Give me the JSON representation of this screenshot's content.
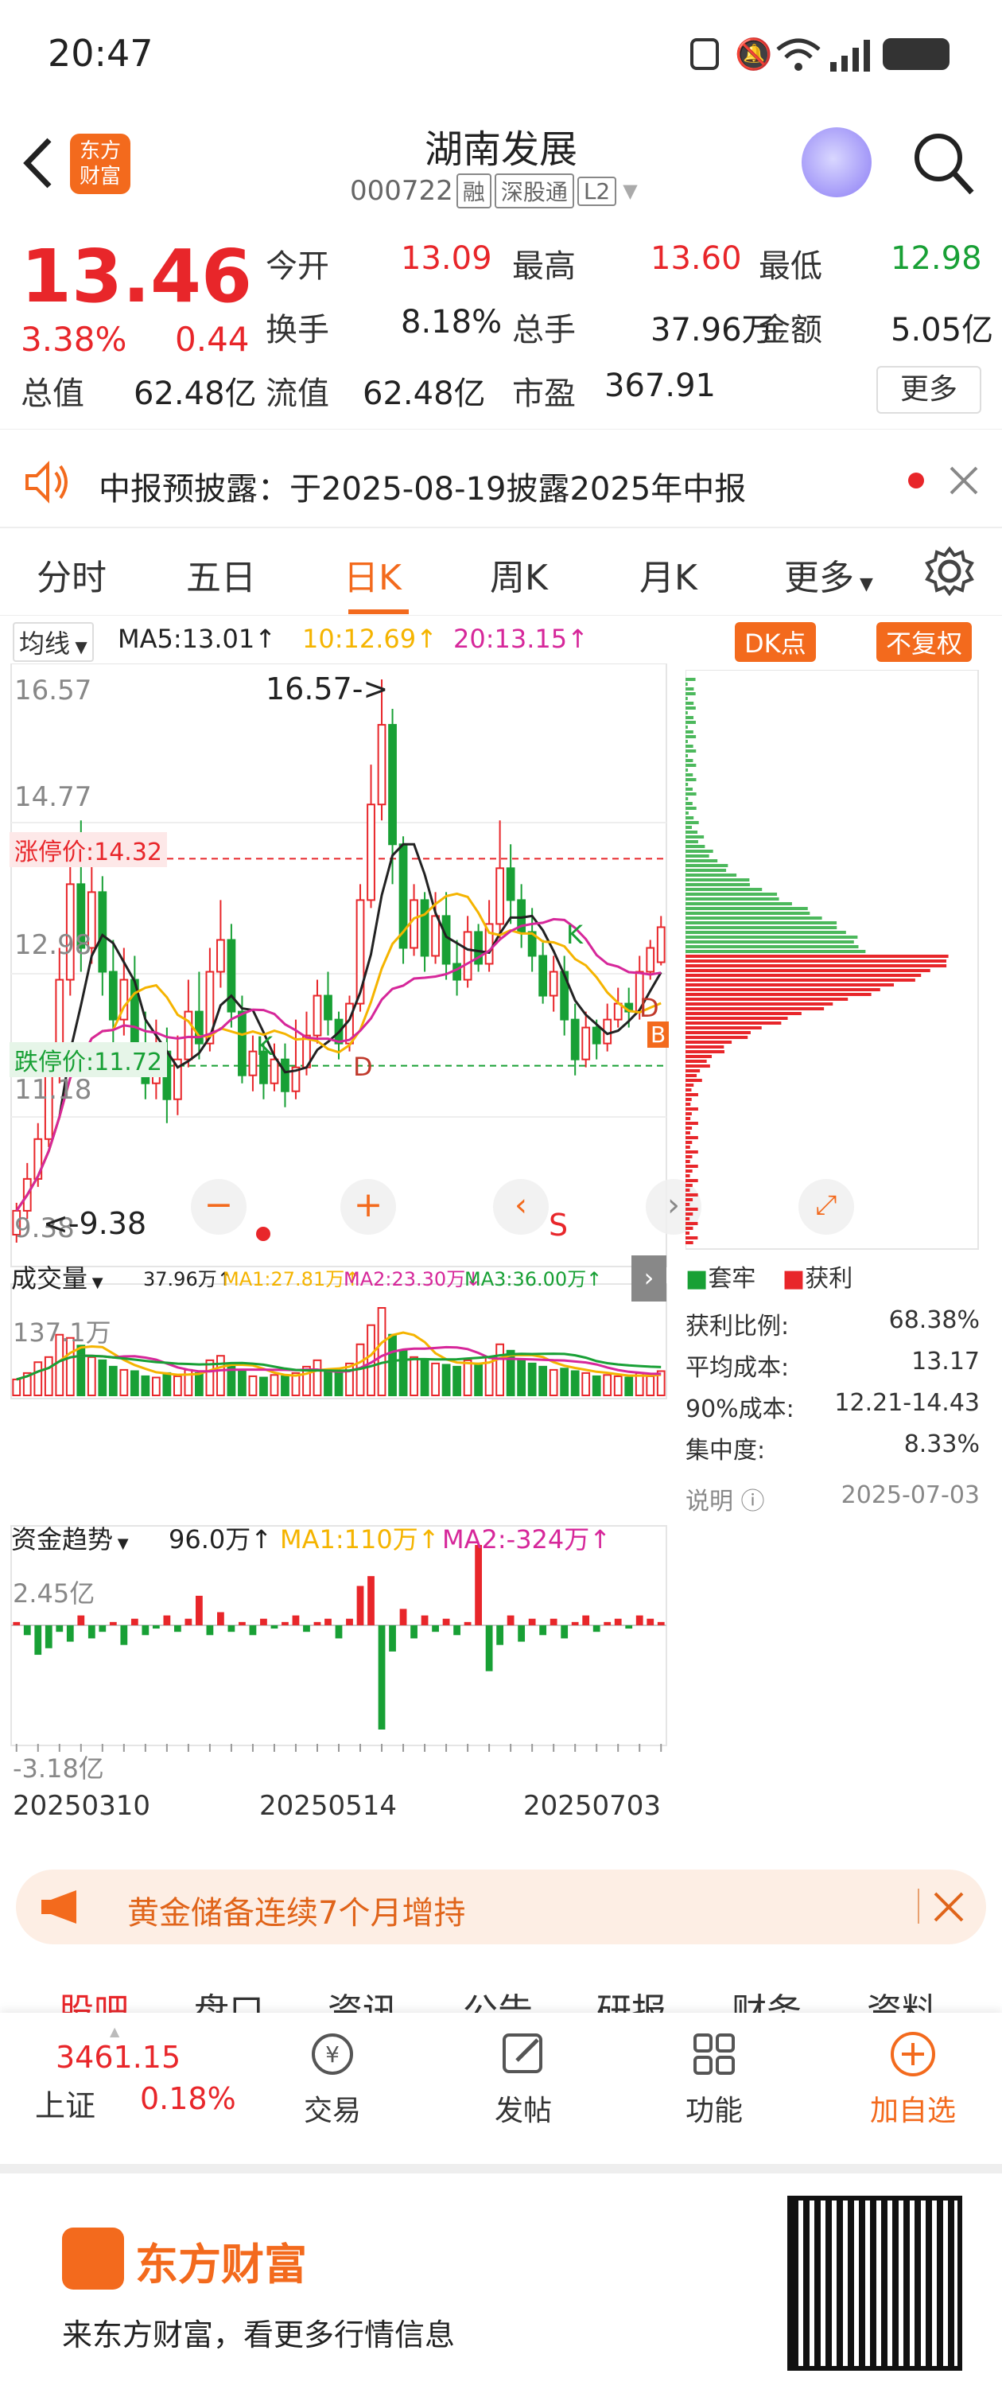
{
  "status": {
    "time": "20:47",
    "icons": [
      "nfc-icon",
      "mute-icon",
      "wifi-icon",
      "signal-icon",
      "battery-icon"
    ]
  },
  "header": {
    "title": "湖南发展",
    "code": "000722",
    "tags": [
      "融",
      "深股通",
      "L2"
    ],
    "logo_text": "东方\n财富"
  },
  "quote": {
    "price": "13.46",
    "change_pct": "3.38%",
    "change": "0.44",
    "stats": [
      {
        "label": "今开",
        "value": "13.09",
        "color": "red"
      },
      {
        "label": "最高",
        "value": "13.60",
        "color": "red"
      },
      {
        "label": "最低",
        "value": "12.98",
        "color": "green"
      },
      {
        "label": "换手",
        "value": "8.18%",
        "color": "dark"
      },
      {
        "label": "总手",
        "value": "37.96万",
        "color": "dark"
      },
      {
        "label": "金额",
        "value": "5.05亿",
        "color": "dark"
      },
      {
        "label": "总值",
        "value": "62.48亿",
        "color": "dark"
      },
      {
        "label": "流值",
        "value": "62.48亿",
        "color": "dark"
      },
      {
        "label": "市盈",
        "value": "367.91",
        "color": "dark"
      }
    ],
    "more_label": "更多"
  },
  "notice": {
    "text": "中报预披露：于2025-08-19披露2025年中报"
  },
  "tabs": [
    "分时",
    "五日",
    "日K",
    "周K",
    "月K",
    "更多"
  ],
  "active_tab": "日K",
  "kline": {
    "indicator": "均线",
    "ma5": "MA5:13.01↑",
    "ma10": "10:12.69↑",
    "ma20": "20:13.15↑",
    "dk_label": "DK点",
    "adjust_label": "不复权",
    "y_labels": [
      "16.57",
      "14.77",
      "12.98",
      "11.18"
    ],
    "high_mark": "16.57->",
    "low_mark": "<-9.38",
    "low_label": "9.38",
    "limit_up": "涨停价:14.32",
    "limit_down": "跌停价:11.72",
    "signal_labels": [
      "K",
      "D",
      "K",
      "D",
      "B",
      "S"
    ]
  },
  "chip": {
    "legend_hold": "套牢",
    "legend_profit": "获利",
    "rows": [
      {
        "label": "获利比例:",
        "value": "68.38%"
      },
      {
        "label": "平均成本:",
        "value": "13.17"
      },
      {
        "label": "90%成本:",
        "value": "12.21-14.43"
      },
      {
        "label": "集中度:",
        "value": "8.33%"
      }
    ],
    "note": "说明",
    "date": "2025-07-03"
  },
  "volume": {
    "label": "成交量",
    "v": "37.96万↑",
    "ma1": "MA1:27.81万↑",
    "ma2": "MA2:23.30万↓",
    "ma3": "MA3:36.00万↑",
    "max": "137.1万"
  },
  "fund": {
    "label": "资金趋势",
    "v": "96.0万↑",
    "ma1": "MA1:110万↑",
    "ma2": "MA2:-324万↑",
    "max": "2.45亿",
    "min": "-3.18亿"
  },
  "dates": [
    "20250310",
    "20250514",
    "20250703"
  ],
  "banner": {
    "text": "黄金储备连续7个月增持"
  },
  "bottom_tabs": [
    "股吧",
    "盘口",
    "资讯",
    "公告",
    "研报",
    "财务",
    "资料"
  ],
  "nav": {
    "index_value": "3461.15",
    "index_name": "上证",
    "index_pct": "0.18%",
    "items": [
      "交易",
      "发帖",
      "功能",
      "加自选"
    ]
  },
  "footer": {
    "brand": "东方财富",
    "slogan": "来东方财富，看更多行情信息"
  },
  "colors": {
    "up": "#e8262a",
    "down": "#18a035",
    "accent": "#f36a1d",
    "ma5": "#222222",
    "ma10": "#f5b400",
    "ma20": "#d6279a"
  },
  "chart_data": {
    "type": "candlestick",
    "y_range": [
      9.38,
      16.57
    ],
    "high": 16.57,
    "low": 9.38,
    "limit_up": 14.32,
    "limit_down": 11.72,
    "candles": [
      [
        9.6,
        9.9,
        9.5,
        10.0
      ],
      [
        9.9,
        10.3,
        9.8,
        10.5
      ],
      [
        10.3,
        10.8,
        10.2,
        11.0
      ],
      [
        10.8,
        11.6,
        10.7,
        11.8
      ],
      [
        11.6,
        12.8,
        11.5,
        13.2
      ],
      [
        12.8,
        14.0,
        12.6,
        14.5
      ],
      [
        14.0,
        13.2,
        12.9,
        14.8
      ],
      [
        13.2,
        13.9,
        13.0,
        14.3
      ],
      [
        13.9,
        12.9,
        12.6,
        14.1
      ],
      [
        12.9,
        12.3,
        12.0,
        13.3
      ],
      [
        12.3,
        12.8,
        12.1,
        13.2
      ],
      [
        12.8,
        12.0,
        11.8,
        13.1
      ],
      [
        12.0,
        11.5,
        11.3,
        12.4
      ],
      [
        11.5,
        11.9,
        11.3,
        12.3
      ],
      [
        11.9,
        11.3,
        11.0,
        12.2
      ],
      [
        11.3,
        11.8,
        11.1,
        12.1
      ],
      [
        11.8,
        12.4,
        11.7,
        12.8
      ],
      [
        12.4,
        12.0,
        11.8,
        12.9
      ],
      [
        12.0,
        12.9,
        11.9,
        13.2
      ],
      [
        12.9,
        13.3,
        12.7,
        13.8
      ],
      [
        13.3,
        12.4,
        12.2,
        13.5
      ],
      [
        12.4,
        11.6,
        11.5,
        12.6
      ],
      [
        11.6,
        11.9,
        11.4,
        12.1
      ],
      [
        11.9,
        11.5,
        11.3,
        12.0
      ],
      [
        11.5,
        11.8,
        11.4,
        12.0
      ],
      [
        11.8,
        11.4,
        11.2,
        12.0
      ],
      [
        11.4,
        11.7,
        11.3,
        12.3
      ],
      [
        11.7,
        12.1,
        11.6,
        12.4
      ],
      [
        12.1,
        12.6,
        12.0,
        12.8
      ],
      [
        12.6,
        12.3,
        12.1,
        12.9
      ],
      [
        12.3,
        12.0,
        11.8,
        12.4
      ],
      [
        12.0,
        12.5,
        11.9,
        12.6
      ],
      [
        12.5,
        13.8,
        12.4,
        14.0
      ],
      [
        13.8,
        15.0,
        13.7,
        15.5
      ],
      [
        15.0,
        16.0,
        14.8,
        16.57
      ],
      [
        16.0,
        14.5,
        14.0,
        16.2
      ],
      [
        14.5,
        13.2,
        13.0,
        14.6
      ],
      [
        13.2,
        13.8,
        13.1,
        14.0
      ],
      [
        13.8,
        13.1,
        12.9,
        13.9
      ],
      [
        13.1,
        13.6,
        13.0,
        13.9
      ],
      [
        13.6,
        13.0,
        12.8,
        13.9
      ],
      [
        13.0,
        12.8,
        12.6,
        13.3
      ],
      [
        12.8,
        13.4,
        12.7,
        13.6
      ],
      [
        13.4,
        13.0,
        12.9,
        13.5
      ],
      [
        13.0,
        13.5,
        12.9,
        13.8
      ],
      [
        13.5,
        14.2,
        13.3,
        14.8
      ],
      [
        14.2,
        13.8,
        13.5,
        14.5
      ],
      [
        13.8,
        13.4,
        13.2,
        14.0
      ],
      [
        13.4,
        13.1,
        12.9,
        13.7
      ],
      [
        13.1,
        12.6,
        12.5,
        13.3
      ],
      [
        12.6,
        12.9,
        12.4,
        13.1
      ],
      [
        12.9,
        12.3,
        12.1,
        13.1
      ],
      [
        12.3,
        11.8,
        11.6,
        12.5
      ],
      [
        11.8,
        12.2,
        11.7,
        12.4
      ],
      [
        12.2,
        12.0,
        11.8,
        12.3
      ],
      [
        12.0,
        12.3,
        11.9,
        12.5
      ],
      [
        12.3,
        12.5,
        12.2,
        12.7
      ],
      [
        12.5,
        12.4,
        12.2,
        12.7
      ],
      [
        12.4,
        12.9,
        12.3,
        13.1
      ],
      [
        12.9,
        13.2,
        12.8,
        13.3
      ],
      [
        13.02,
        13.46,
        12.98,
        13.6
      ]
    ],
    "volumes": [
      25,
      35,
      52,
      60,
      95,
      90,
      78,
      60,
      55,
      45,
      40,
      38,
      30,
      28,
      35,
      30,
      40,
      35,
      55,
      62,
      48,
      40,
      30,
      28,
      32,
      30,
      35,
      45,
      55,
      40,
      35,
      50,
      80,
      110,
      137,
      95,
      70,
      60,
      55,
      50,
      48,
      45,
      55,
      50,
      60,
      80,
      70,
      55,
      50,
      45,
      40,
      42,
      38,
      35,
      30,
      32,
      30,
      28,
      35,
      30,
      38
    ],
    "fund_flow": [
      0.1,
      -0.3,
      -0.9,
      -0.7,
      -0.2,
      -0.5,
      0.3,
      -0.4,
      -0.2,
      0.1,
      -0.6,
      0.2,
      -0.3,
      -0.1,
      0.3,
      -0.2,
      0.2,
      0.9,
      -0.3,
      0.4,
      -0.2,
      0.1,
      -0.3,
      0.2,
      -0.1,
      0.1,
      0.3,
      -0.2,
      0.1,
      0.2,
      -0.4,
      0.2,
      1.2,
      1.5,
      -3.18,
      -0.8,
      0.5,
      -0.4,
      0.3,
      -0.2,
      0.2,
      -0.3,
      0.1,
      2.45,
      -1.4,
      -0.6,
      0.3,
      -0.5,
      0.2,
      -0.3,
      0.2,
      -0.4,
      0.1,
      0.3,
      -0.2,
      0.1,
      0.2,
      -0.1,
      0.3,
      0.2,
      0.1
    ]
  }
}
